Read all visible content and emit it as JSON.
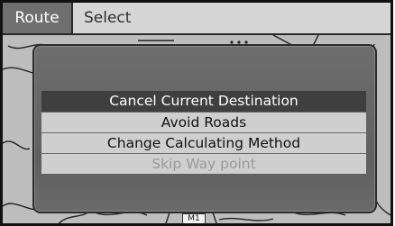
{
  "tabs": {
    "route": "Route",
    "select": "Select"
  },
  "menu": {
    "items": [
      {
        "label": "Cancel Current Destination",
        "state": "selected"
      },
      {
        "label": "Avoid Roads",
        "state": "normal"
      },
      {
        "label": "Change Calculating Method",
        "state": "normal"
      },
      {
        "label": "Skip Way point",
        "state": "disabled"
      }
    ]
  },
  "map": {
    "road_label": "M1"
  }
}
